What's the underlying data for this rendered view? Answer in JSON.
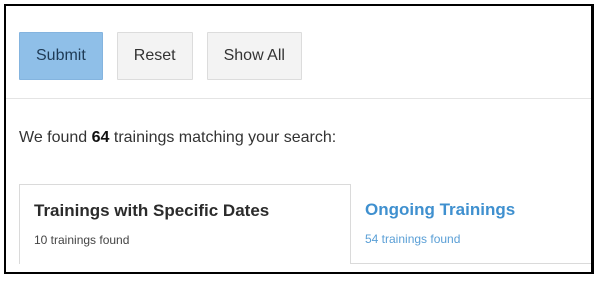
{
  "toolbar": {
    "submit_label": "Submit",
    "reset_label": "Reset",
    "show_all_label": "Show All"
  },
  "results": {
    "prefix": "We found ",
    "count": "64",
    "suffix": " trainings matching your search:"
  },
  "tabs": [
    {
      "title": "Trainings with Specific Dates",
      "count_text": "10 trainings found",
      "active": true
    },
    {
      "title": "Ongoing Trainings",
      "count_text": "54 trainings found",
      "active": false
    }
  ],
  "colors": {
    "submit_bg": "#8fbfe8",
    "link": "#3f90cf"
  }
}
